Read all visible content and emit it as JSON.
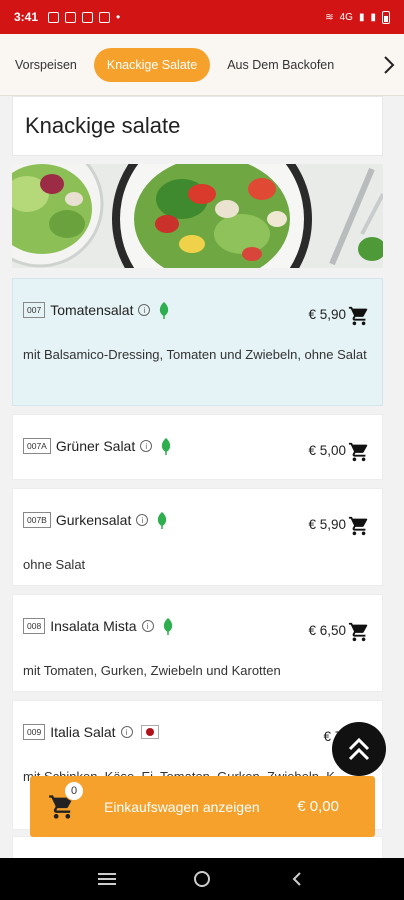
{
  "status_bar": {
    "time": "3:41",
    "network": "4G"
  },
  "tabs": [
    {
      "label": "Vorspeisen",
      "active": false
    },
    {
      "label": "Knackige Salate",
      "active": true
    },
    {
      "label": "Aus Dem Backofen",
      "active": false
    }
  ],
  "section": {
    "title": "Knackige salate"
  },
  "items": [
    {
      "code": "007",
      "name": "Tomatensalat",
      "price": "€ 5,90",
      "desc": "mit Balsamico-Dressing, Tomaten und Zwiebeln, ohne Salat",
      "badge": "leaf-icon"
    },
    {
      "code": "007A",
      "name": "Grüner Salat",
      "price": "€ 5,00",
      "desc": "",
      "badge": "leaf-icon"
    },
    {
      "code": "007B",
      "name": "Gurkensalat",
      "price": "€ 5,90",
      "desc": "ohne Salat",
      "badge": "leaf-icon"
    },
    {
      "code": "008",
      "name": "Insalata Mista",
      "price": "€ 6,50",
      "desc": "mit Tomaten, Gurken, Zwiebeln und Karotten",
      "badge": "leaf-icon"
    },
    {
      "code": "009",
      "name": "Italia Salat",
      "price": "€ 7,",
      "desc": "mit Schinken, Käse, Ei, Tomaten, Gurken, Zwiebeln, K",
      "badge": "flag-icon"
    }
  ],
  "cart": {
    "count": "0",
    "label": "Einkaufswagen anzeigen",
    "total": "€ 0,00"
  },
  "colors": {
    "accent": "#f5a12c",
    "status": "#d21414",
    "highlight": "#e6f3f6",
    "leaf": "#2eae4f"
  }
}
